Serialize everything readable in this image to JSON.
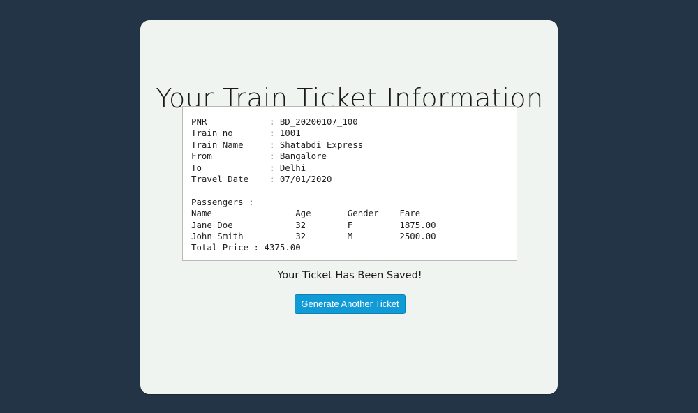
{
  "page": {
    "title": "Your Train Ticket Information",
    "saved_message": "Your Ticket Has Been Saved!",
    "generate_button_label": "Generate Another Ticket"
  },
  "ticket": {
    "text": "PNR            : BD_20200107_100\nTrain no       : 1001\nTrain Name     : Shatabdi Express\nFrom           : Bangalore\nTo             : Delhi\nTravel Date    : 07/01/2020\n\nPassengers :\nName                Age       Gender    Fare\nJane Doe            32        F         1875.00\nJohn Smith          32        M         2500.00\nTotal Price : 4375.00",
    "pnr": "BD_20200107_100",
    "train_no": "1001",
    "train_name": "Shatabdi Express",
    "from": "Bangalore",
    "to": "Delhi",
    "travel_date": "07/01/2020",
    "passengers": [
      {
        "name": "Jane Doe",
        "age": "32",
        "gender": "F",
        "fare": "1875.00"
      },
      {
        "name": "John Smith",
        "age": "32",
        "gender": "M",
        "fare": "2500.00"
      }
    ],
    "total_price": "4375.00"
  },
  "colors": {
    "background": "#243447",
    "card": "#eff4f1",
    "button": "#119bd6"
  }
}
